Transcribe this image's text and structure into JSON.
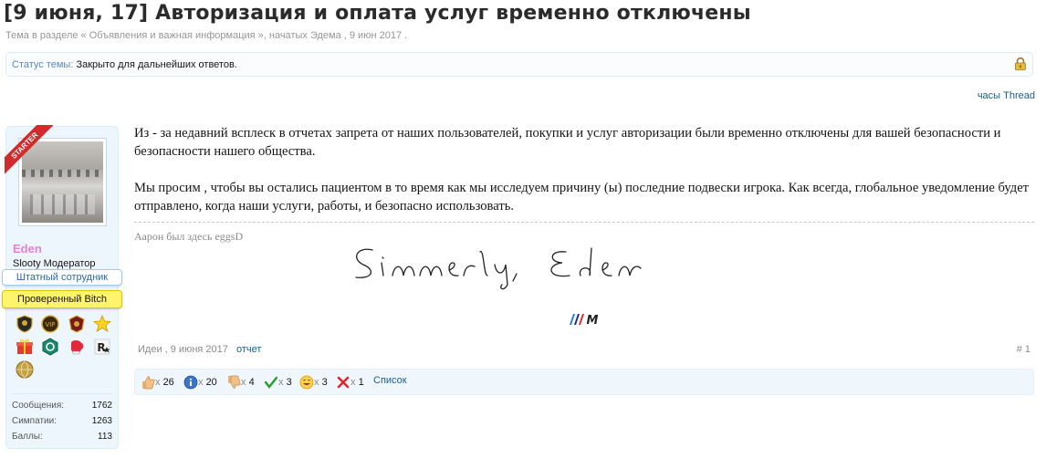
{
  "thread": {
    "title": "[9 июня, 17] Авторизация и оплата услуг временно отключены",
    "meta_prefix": "Тема в разделе « ",
    "forum_link": "Объявления и важная информация",
    "meta_middle": " », начатых ",
    "author_link": "Эдема",
    "meta_date": " , 9 июн 2017 ."
  },
  "status": {
    "label": "Статус темы:",
    "value": "Закрыто для дальнейших ответов.",
    "icon": "lock-icon"
  },
  "rss_line": "часы Thread",
  "user": {
    "ribbon": "STARTER",
    "name": "Eden",
    "name_color": "#e67fd8",
    "title": "Slooty Модератор",
    "banner_staff": "Штатный сотрудник",
    "banner_verified": "Проверенный Bitch",
    "stats": [
      {
        "label": "Сообщения:",
        "value": "1762"
      },
      {
        "label": "Симпатии:",
        "value": "1263"
      },
      {
        "label": "Баллы:",
        "value": "113"
      }
    ]
  },
  "post": {
    "paragraph1": "Из - за недавний всплеск в отчетах запрета от наших пользователей, покупки и услуг авторизации были временно отключены для вашей безопасности и безопасности нашего общества.",
    "paragraph2": "Мы просим , чтобы вы остались пациентом в то время как мы исследуем причину (ы) последние подвески игрока. Как всегда, глобальное уведомление будет отправлено, когда наши услуги, работы, и безопасно использовать.",
    "signature_text": "Аарон был здесь eggsD",
    "footer_author": "Идеи",
    "footer_date": " , 9 июня 2017",
    "report": "отчет",
    "post_number": "# 1"
  },
  "ratings": [
    {
      "icon": "like-icon",
      "prefix": "x ",
      "count": "26"
    },
    {
      "icon": "info-icon",
      "prefix": "x ",
      "count": "20"
    },
    {
      "icon": "dislike-icon",
      "prefix": "x ",
      "count": "4"
    },
    {
      "icon": "agree-icon",
      "prefix": "x ",
      "count": "3"
    },
    {
      "icon": "funny-icon",
      "prefix": "x ",
      "count": "3"
    },
    {
      "icon": "disagree-icon",
      "prefix": "x ",
      "count": "1"
    }
  ],
  "ratings_list": "Список",
  "colors": {
    "link": "#176093",
    "status_border": "#d7edfc",
    "verified_banner": "#fff46b"
  }
}
